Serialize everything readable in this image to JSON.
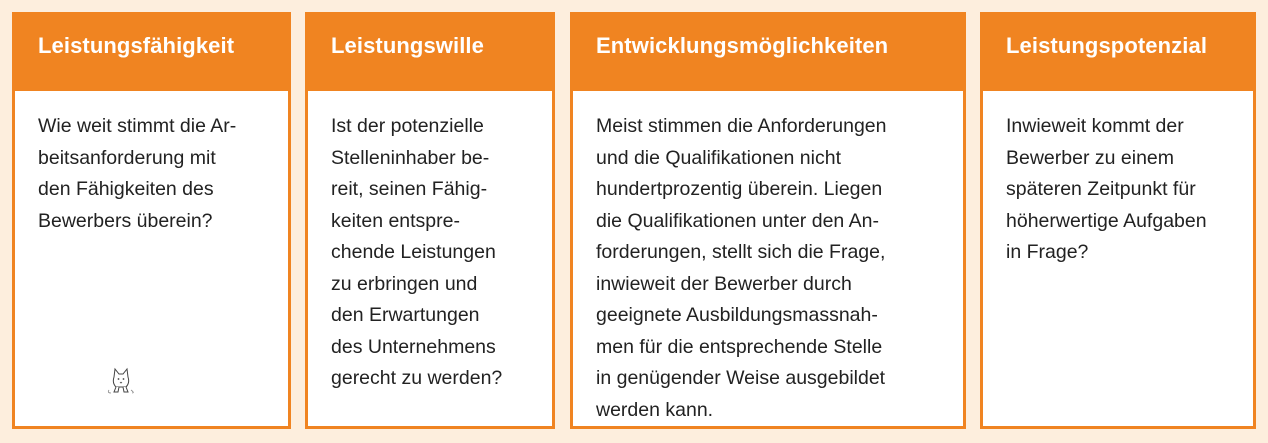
{
  "colors": {
    "accent": "#f08421",
    "background": "#fdeedd",
    "card": "#ffffff",
    "text": "#222222"
  },
  "cards": [
    {
      "title": "Leistungsfähigkeit",
      "lines": [
        "Wie weit stimmt die Ar-",
        "beitsanforderung mit",
        "den Fähigkeiten des",
        "Bewerbers überein?"
      ]
    },
    {
      "title": "Leistungswille",
      "lines": [
        "Ist der potenzielle",
        "Stelleninhaber be-",
        "reit, seinen Fähig-",
        "keiten entspre-",
        "chende Leistungen",
        "zu erbringen und",
        "den Erwartungen",
        "des Unternehmens",
        "gerecht zu werden?"
      ]
    },
    {
      "title": "Entwicklungsmöglichkeiten",
      "lines": [
        "Meist stimmen die Anforderungen",
        "und die Qualifikationen nicht",
        "hundertprozentig überein. Liegen",
        "die Qualifikationen unter den An-",
        "forderungen, stellt sich die Frage,",
        "inwieweit der Bewerber durch",
        "geeignete Ausbildungsmassnah-",
        "men für die entsprechende Stelle",
        "in genügender Weise ausgebildet",
        "werden kann."
      ]
    },
    {
      "title": "Leistungspotenzial",
      "lines": [
        "Inwieweit kommt der",
        "Bewerber zu einem",
        "späteren Zeitpunkt für",
        "höherwertige Aufgaben",
        "in Frage?"
      ]
    }
  ],
  "decoration": {
    "icon": "cat-mascot-icon"
  }
}
